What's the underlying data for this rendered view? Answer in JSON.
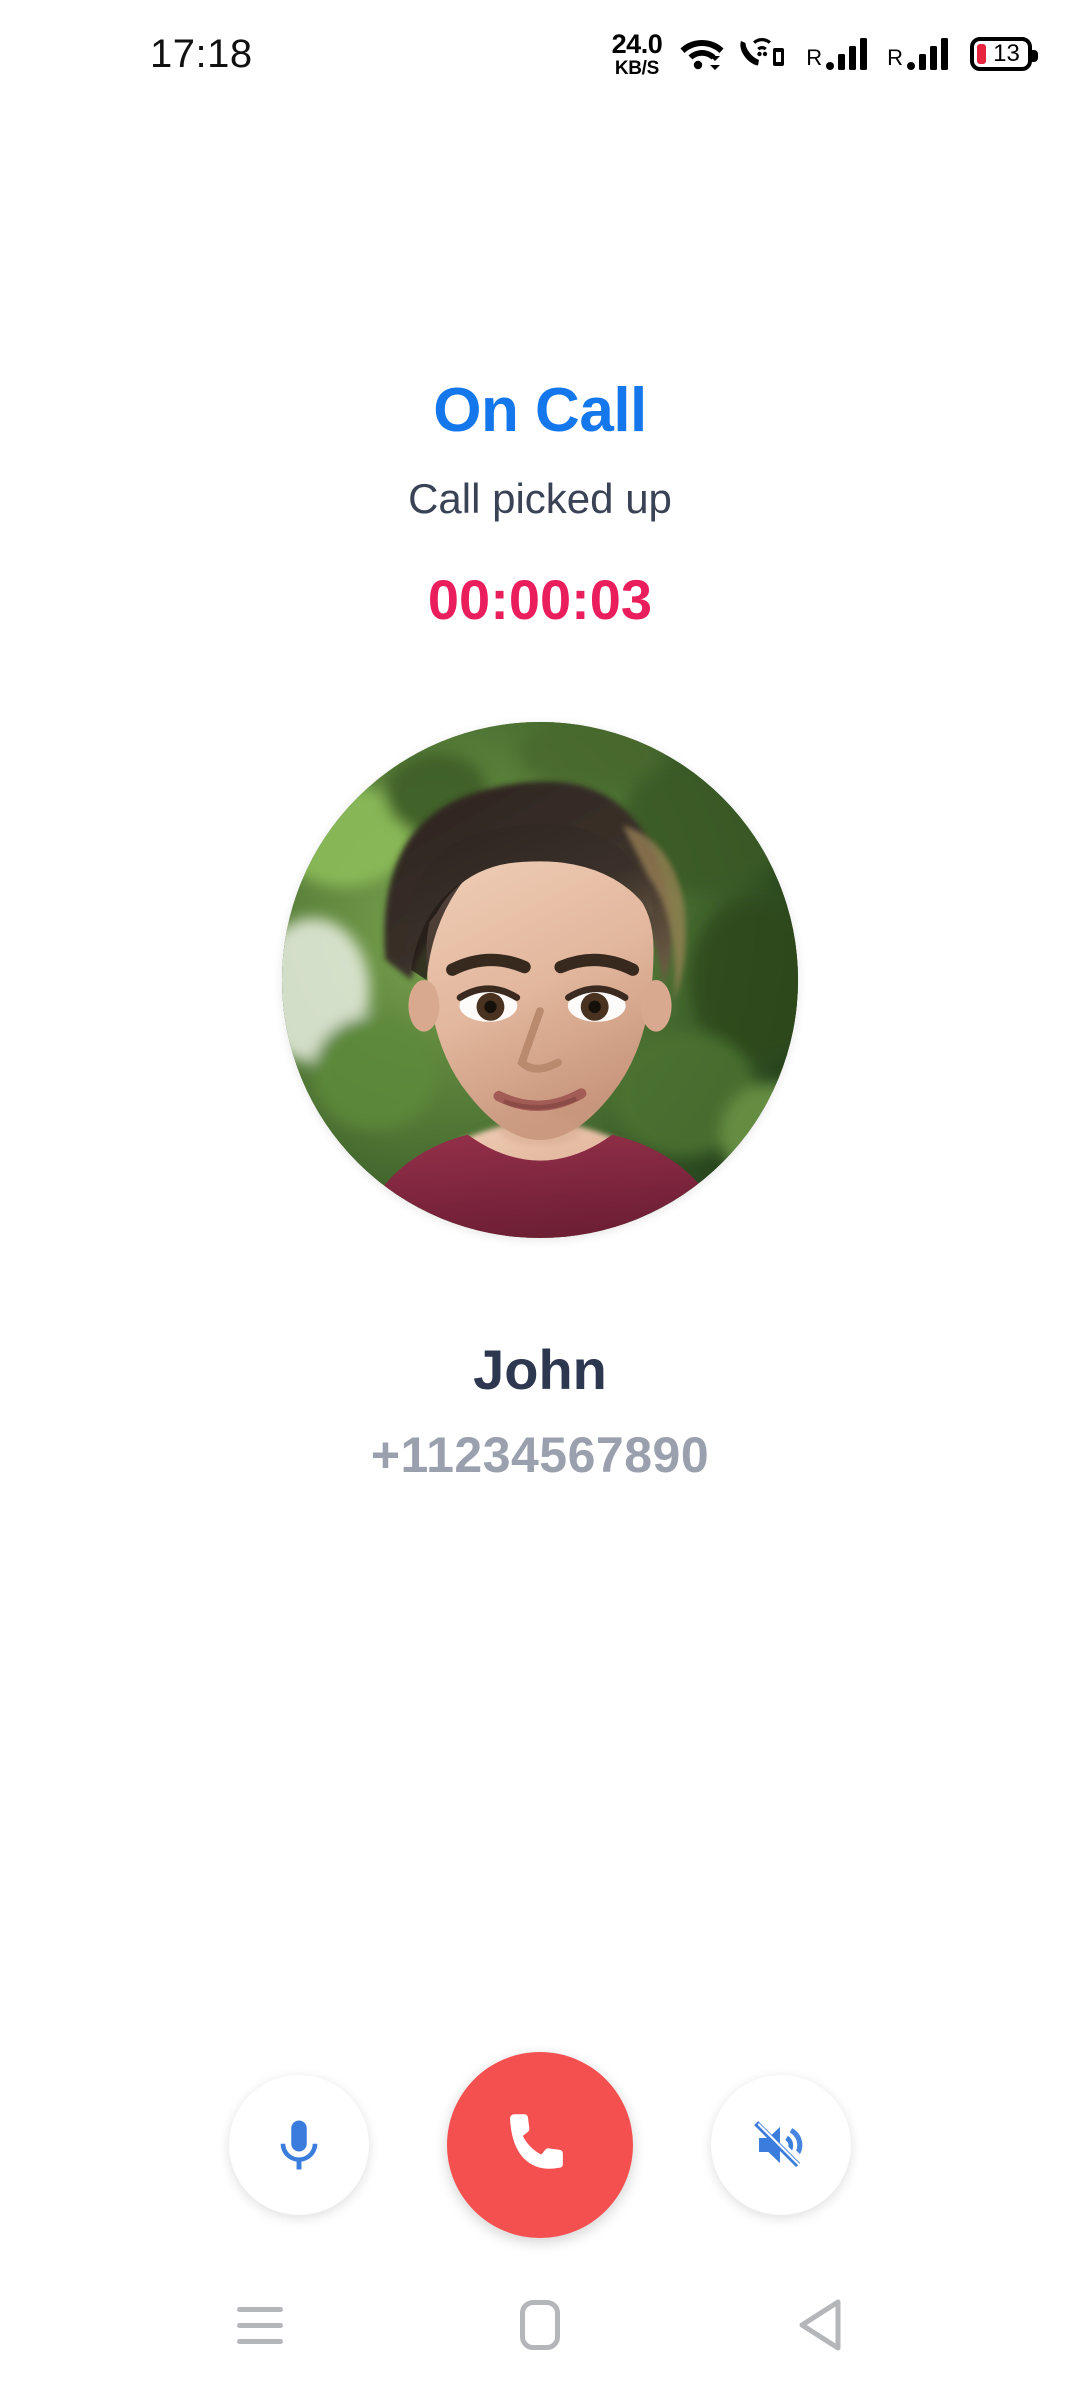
{
  "status_bar": {
    "time": "17:18",
    "net_speed_value": "24.0",
    "net_speed_unit": "KB/S",
    "wifi_icon": "wifi-icon",
    "call_wifi_icon": "wifi-calling-icon",
    "sim1_roaming": "R",
    "sim2_roaming": "R",
    "battery_level": "13"
  },
  "call": {
    "state": "On Call",
    "status_text": "Call picked up",
    "duration": "00:00:03",
    "state_color": "#1577ec",
    "status_color": "#3a4256",
    "duration_color": "#ea1d5d"
  },
  "contact": {
    "name": "John",
    "number": "+11234567890",
    "avatar_alt": "contact-photo",
    "name_color": "#2e3750",
    "number_color": "#9aa0ad"
  },
  "controls": {
    "mute_mic": {
      "icon": "microphone-icon",
      "color": "#3b7ddd"
    },
    "end_call": {
      "icon": "phone-handset-icon",
      "background": "#f4504f",
      "icon_color": "#ffffff"
    },
    "speaker": {
      "icon": "speaker-muted-icon",
      "color": "#3b7ddd"
    }
  },
  "nav_bar": {
    "recents": "recents-icon",
    "home": "home-icon",
    "back": "back-icon",
    "color": "#b4b6b9"
  }
}
